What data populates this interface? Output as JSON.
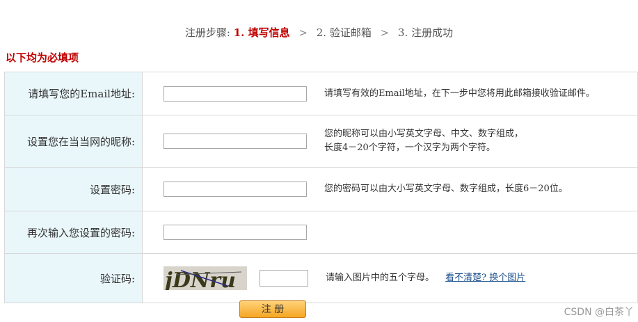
{
  "steps": {
    "prefix": "注册步骤:",
    "step1": "1. 填写信息",
    "arrow": ">",
    "step2": "2. 验证邮箱",
    "step3": "3. 注册成功"
  },
  "required_note": "以下均为必填项",
  "rows": [
    {
      "label": "请填写您的Email地址:",
      "hint_lines": [
        "请填写有效的Email地址，在下一步中您将用此邮箱接收验证邮件。"
      ]
    },
    {
      "label": "设置您在当当网的昵称:",
      "hint_lines": [
        "您的昵称可以由小写英文字母、中文、数字组成，",
        "长度4－20个字符，一个汉字为两个字符。"
      ]
    },
    {
      "label": "设置密码:",
      "hint_lines": [
        "您的密码可以由大小写英文字母、数字组成，长度6－20位。"
      ]
    },
    {
      "label": "再次输入您设置的密码:",
      "hint_lines": []
    },
    {
      "label": "验证码:",
      "hint_lines": [
        "请输入图片中的五个字母。"
      ],
      "link": "看不清楚? 换个图片",
      "captcha_text": "jDNru"
    }
  ],
  "submit_label": "注 册",
  "watermark": "CSDN @白茶丫",
  "colors": {
    "accent": "#c00000",
    "label_bg": "#e9f7fb",
    "link": "#1a4f8c",
    "button": "#f5a623"
  }
}
